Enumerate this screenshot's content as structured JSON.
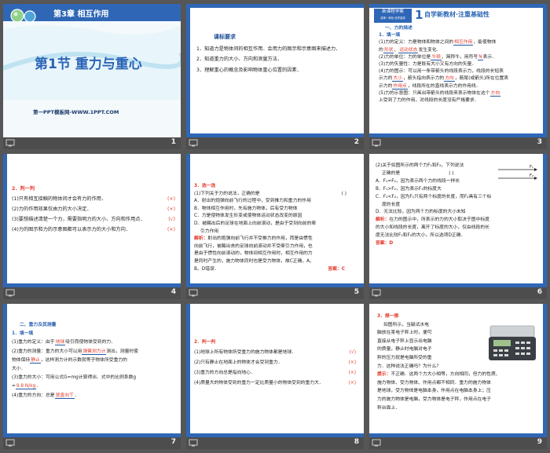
{
  "colors": {
    "frame": "#2f67b6",
    "accent_red": "#e23a2a",
    "title_blue": "#2a63b6",
    "sect_blue": "#2b63b5"
  },
  "icons": {
    "slide_bar": "slideshow-icon",
    "swoosh": "wave-swoosh-icon",
    "scale": "electronic-scale-image"
  },
  "s1": {
    "chapter": "第3章 相互作用",
    "title": "第1节 重力与重心",
    "site": "第一PPT模板网-WWW.1PPT.COM",
    "num": "1"
  },
  "s2": {
    "heading": "课标要求",
    "items": [
      "1．知道力是物体间的相互作用．会用力的图示和示意图来描述力．",
      "2．知道重力的大小、方向和测量方法．",
      "3．理解重心的概念及影响物体重心位置的因素．"
    ],
    "num": "2"
  },
  "s3": {
    "badge_top": "新课程学案",
    "badge_bottom": "讲练一体化·优学高效",
    "badge_num": "1",
    "header": "自学新教材·注重基础性",
    "sec": "一、力的描述",
    "sub": "1．填一填",
    "l1a": "(1)力的定义：力是物体和物体之间的",
    "l1b": "相互作用",
    "l1c": "，能使物体",
    "l2a": "的",
    "l2b": "形状",
    "l2c": "、",
    "l2d": "运动状态",
    "l2e": "发生变化．",
    "l3a": "(2)力的单位：力的单位是",
    "l3b": "牛顿",
    "l3c": "，简称牛，用符号",
    "l3d": "N",
    "l3e": "表示．",
    "l4": "(3)力的矢量性：力是既有大小又有方向的矢量．",
    "l5": "(4)力的图示：可以用一条带箭头的线段表示力，线段的长短表",
    "l6a": "示力的",
    "l6b": "大小",
    "l6c": "，箭头指向表示力的",
    "l6d": "方向",
    "l6e": "，箭尾(或箭头)所在位置表",
    "l7a": "示力的",
    "l7b": "作用点",
    "l7c": "，线段所在的直线表示力的作用线．",
    "l8a": "(5)力的示意图：只画出带箭头的线段来表示物体在这个",
    "l8b": "方向",
    "l9": "上受到了力的作用，对线段的长度没有严格要求．",
    "num": "3"
  },
  "s4": {
    "head": "2．判一判",
    "rows": [
      {
        "text": "(1)只有相互接触的物体间才会有力的作用．",
        "mark": "(×)"
      },
      {
        "text": "(2)力的作用效果仅由力的大小决定．",
        "mark": "(×)"
      },
      {
        "text": "(3)要想描述清楚一个力，需要指明力的大小、方向和作用点．",
        "mark": "(√)"
      },
      {
        "text": "(4)力的图示和力的示意图都可以表示力的大小和方向．",
        "mark": "(×)"
      }
    ],
    "num": "4"
  },
  "s5": {
    "head": "3．选一选",
    "q": "(1)下列关于力的说法，正确的是",
    "paren": "(      )",
    "opts": [
      "A．射出的炮弹向前飞行的过程中，受到推力和重力的作用",
      "B．物体相互作用时，先有施力物体，后有受力物体",
      "C．力是使物体发生形变或使物体运动状态改变的原因",
      "D．被踢出后的足球在地面上向前滚动，是由于受到向前的牵",
      "引力作用"
    ],
    "expl_label": "解析：",
    "expl": [
      "射出的炮弹向前飞行并不受推力的作用，而是由惯性",
      "向前飞行，被踢出去的足球向前滚动并不受牵引力作用，也",
      "是由于惯性向前滚动的，物体间相互作用时，相互作用的力",
      "是同时产生的，施力物体同时也是受力物体，故C正确，A、",
      "B、D错误．"
    ],
    "ans": "答案：C",
    "num": "5"
  },
  "s6": {
    "q1": "(2)关于如图所示的两个力F₁和F₂，下列说法",
    "q2": "正确的是",
    "paren": "(      )",
    "f1": "F₁",
    "f2": "F₂",
    "opts": [
      "A．F₁=F₂，因为表示两个力的线段一样长",
      "B．F₁>F₂，因为表示F₁的标度大",
      "C．F₁<F₂，因为F₁只有两个标度的长度，而F₂具有三个标",
      "度的长度",
      "D．无法比较，因为两个力的标度的大小未知"
    ],
    "expl_label": "解析：",
    "expl": [
      "在力的图示中，所表示的力的大小取决于图中标度",
      "的大小和线段的长度，离开了标度的大小，仅由线段的长",
      "度无法比较F₁和F₂的大小，所以选项D正确．"
    ],
    "ans": "答案：D",
    "num": "6"
  },
  "s7": {
    "sec": "二、重力及其测量",
    "sub": "1．填一填",
    "l1a": "(1)重力的定义：由于",
    "l1b": "地球",
    "l1c": "吸引而使物体受到的力．",
    "l2a": "(2)重力的测量：重力的大小可以用",
    "l2b": "弹簧测力计",
    "l2c": "测出，测量时使",
    "l3a": "物体保持",
    "l3b": "静止",
    "l3c": "，这样测力计的示数就等于物体所受重力的",
    "l4": "大小．",
    "l5": "(3)重力的大小：可用公式G=mg计算得出．式中的比例系数g",
    "l6a": "=",
    "l6b": "9.8 N/kg",
    "l6c": "．",
    "l7a": "(4)重力的方向：总是",
    "l7b": "竖直向下",
    "l7c": "．",
    "num": "7"
  },
  "s8": {
    "head": "2．判一判",
    "rows": [
      {
        "text": "(1)地球上所有物体所受重力的施力物体都是地球．",
        "mark": "(√)"
      },
      {
        "text": "(2)只有静止在地面上的物体才会受到重力．",
        "mark": "(×)"
      },
      {
        "text": "(3)重力的方向总是指向地心．",
        "mark": "(×)"
      },
      {
        "text": "(4)质量大的物体受到的重力一定比质量小的物体受到的重力大．",
        "mark": "(×)"
      }
    ],
    "num": "8"
  },
  "s9": {
    "head": "3．想一想",
    "q": [
      "如图所示，当磁试水电",
      "脑放在某电子秤上时，便可",
      "直接从电子秤上显示出电脑",
      "的质量，静止时电脑对电子",
      "秤的压力就是电脑所受的重",
      "力．这种说法正确吗？为什么？"
    ],
    "hint_label": "提示：",
    "hint": [
      "不正确．这两个力大小相等，方向相同，但力的性质、",
      "施力物体、受力物体、作用点都不相同．重力的施力物体",
      "是地球，受力物体是电脑本身，作用点在电脑本身上；压",
      "力的施力物体是电脑，受力物体是电子秤，作用点在电子",
      "秤台面上．"
    ],
    "num": "9"
  }
}
